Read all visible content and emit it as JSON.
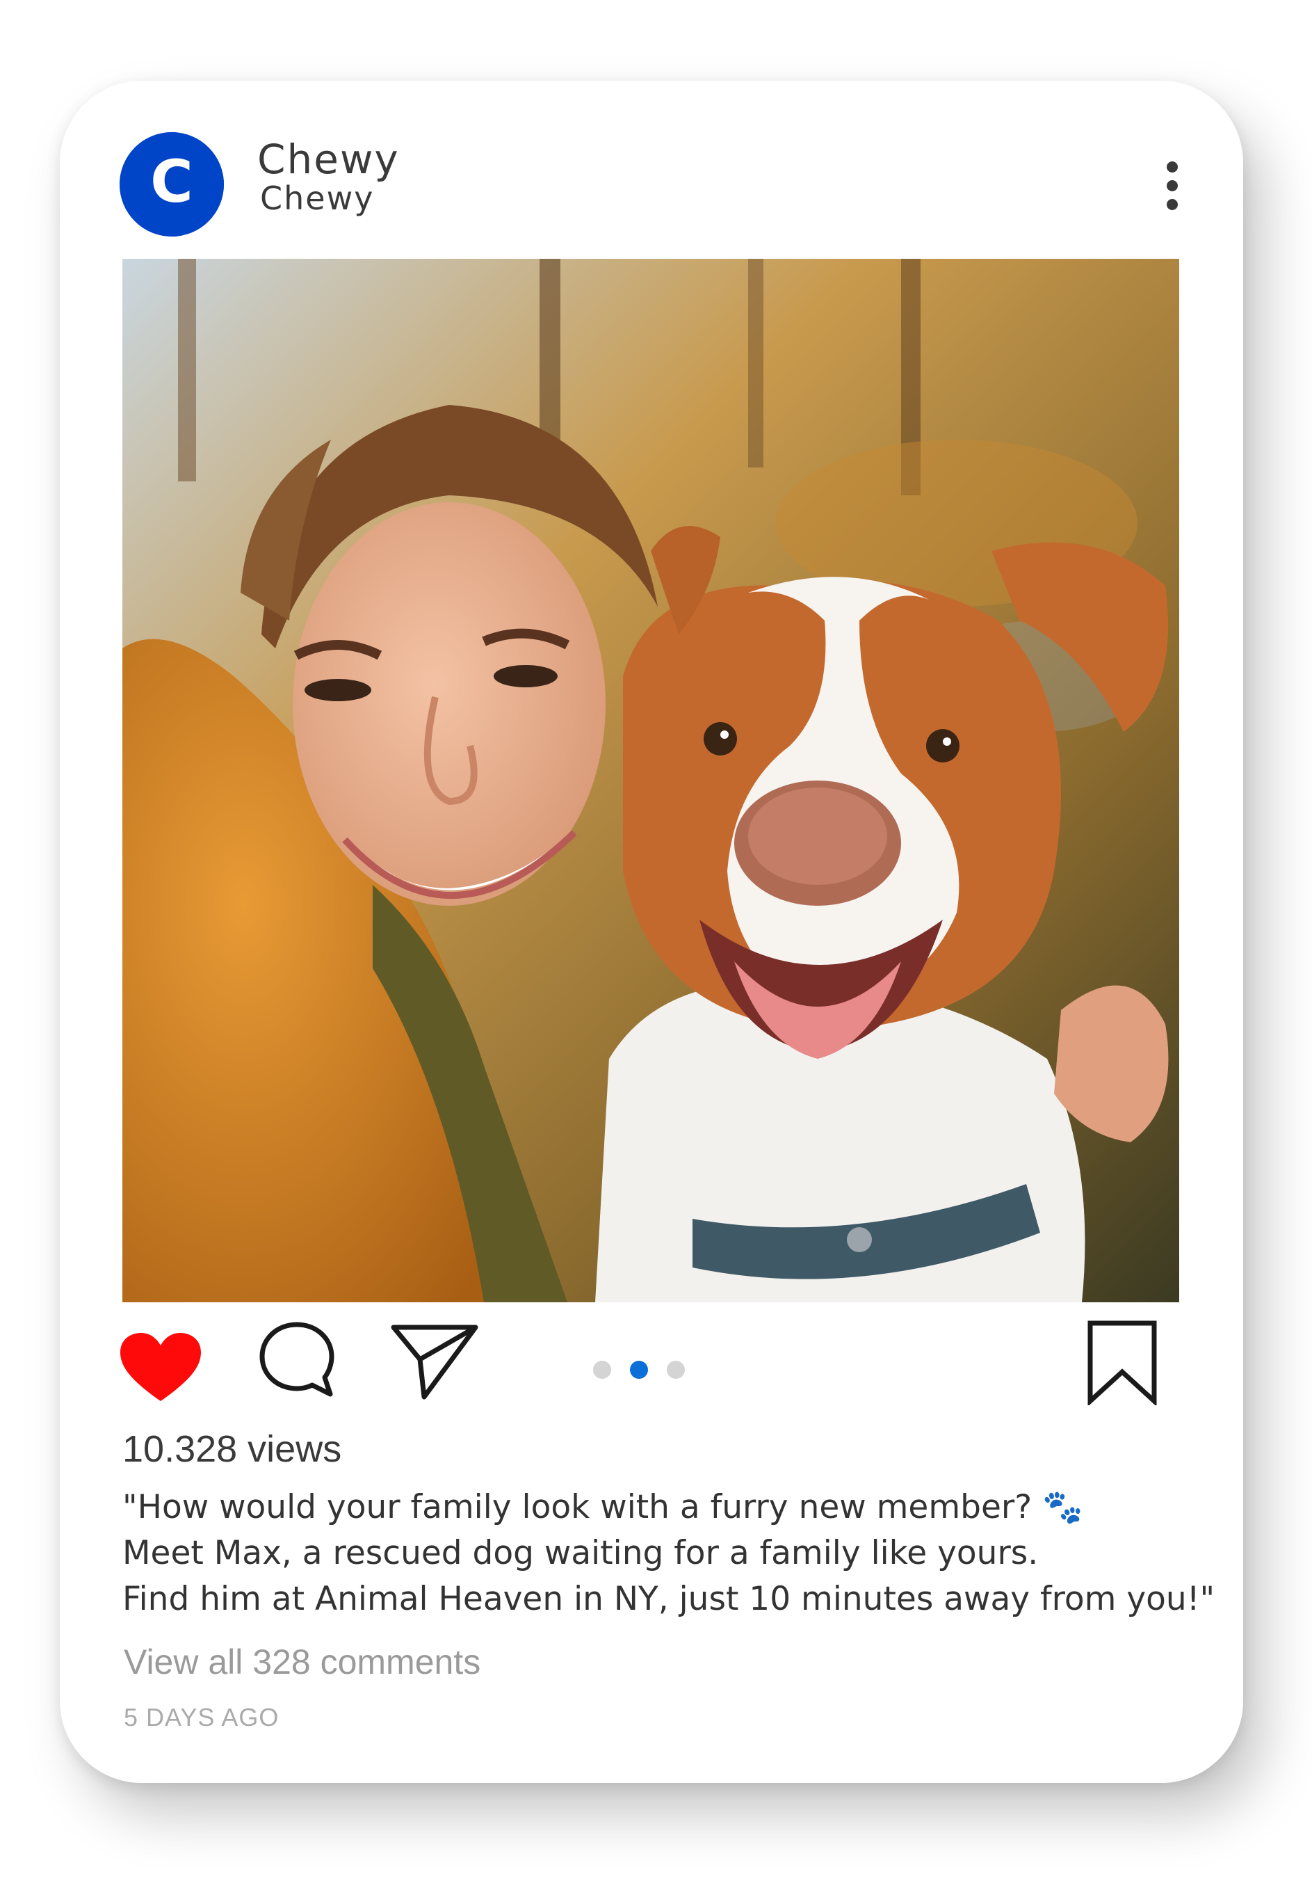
{
  "colors": {
    "brand": "#0044c8",
    "like_active": "#ff0a0a",
    "dot_active": "#0a6fd6",
    "dot_inactive": "#d4d4d4",
    "text": "#3a3a3a",
    "muted": "#9a9a9a"
  },
  "post": {
    "account": {
      "logo_letter": "C",
      "name": "Chewy",
      "subtitle": "Chewy"
    },
    "media": {
      "pagination": {
        "current": 2,
        "total": 3
      }
    },
    "actions": {
      "like_icon": "heart-filled-icon",
      "comment_icon": "speech-bubble-icon",
      "share_icon": "paper-plane-icon",
      "save_icon": "bookmark-icon",
      "more_icon": "vertical-ellipsis-icon"
    },
    "views": "10.328 views",
    "caption": {
      "line1": "\"How would your family look with a furry new member?",
      "paw_emoji": "🐾",
      "line2": "Meet Max, a rescued dog waiting for a family like yours.",
      "line3": "Find him at Animal Heaven in NY, just 10 minutes away from you!\""
    },
    "view_comments": "View all 328 comments",
    "timestamp": "5 DAYS AGO"
  }
}
